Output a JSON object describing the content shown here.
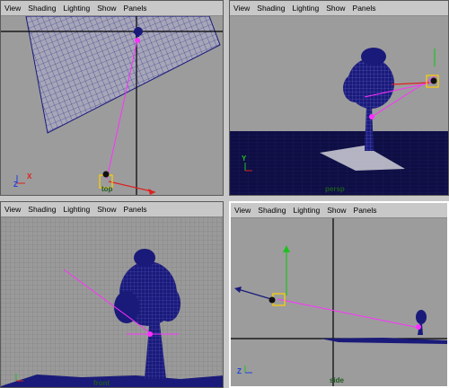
{
  "menu": [
    "View",
    "Shading",
    "Lighting",
    "Show",
    "Panels"
  ],
  "panels": {
    "top": {
      "camera_label": "top"
    },
    "persp": {
      "camera_label": "persp"
    },
    "front": {
      "camera_label": "front"
    },
    "side": {
      "camera_label": "side"
    }
  },
  "axes": {
    "x": "X",
    "y": "Y",
    "z": "Z"
  },
  "colors": {
    "viewport_bg": "#9c9c9c",
    "wire": "#1a1a7a",
    "light_path": "#ff30ff",
    "axis_x": "#e02020",
    "axis_y": "#20c020",
    "axis_z": "#2040e0",
    "selection": "#ffd000"
  }
}
